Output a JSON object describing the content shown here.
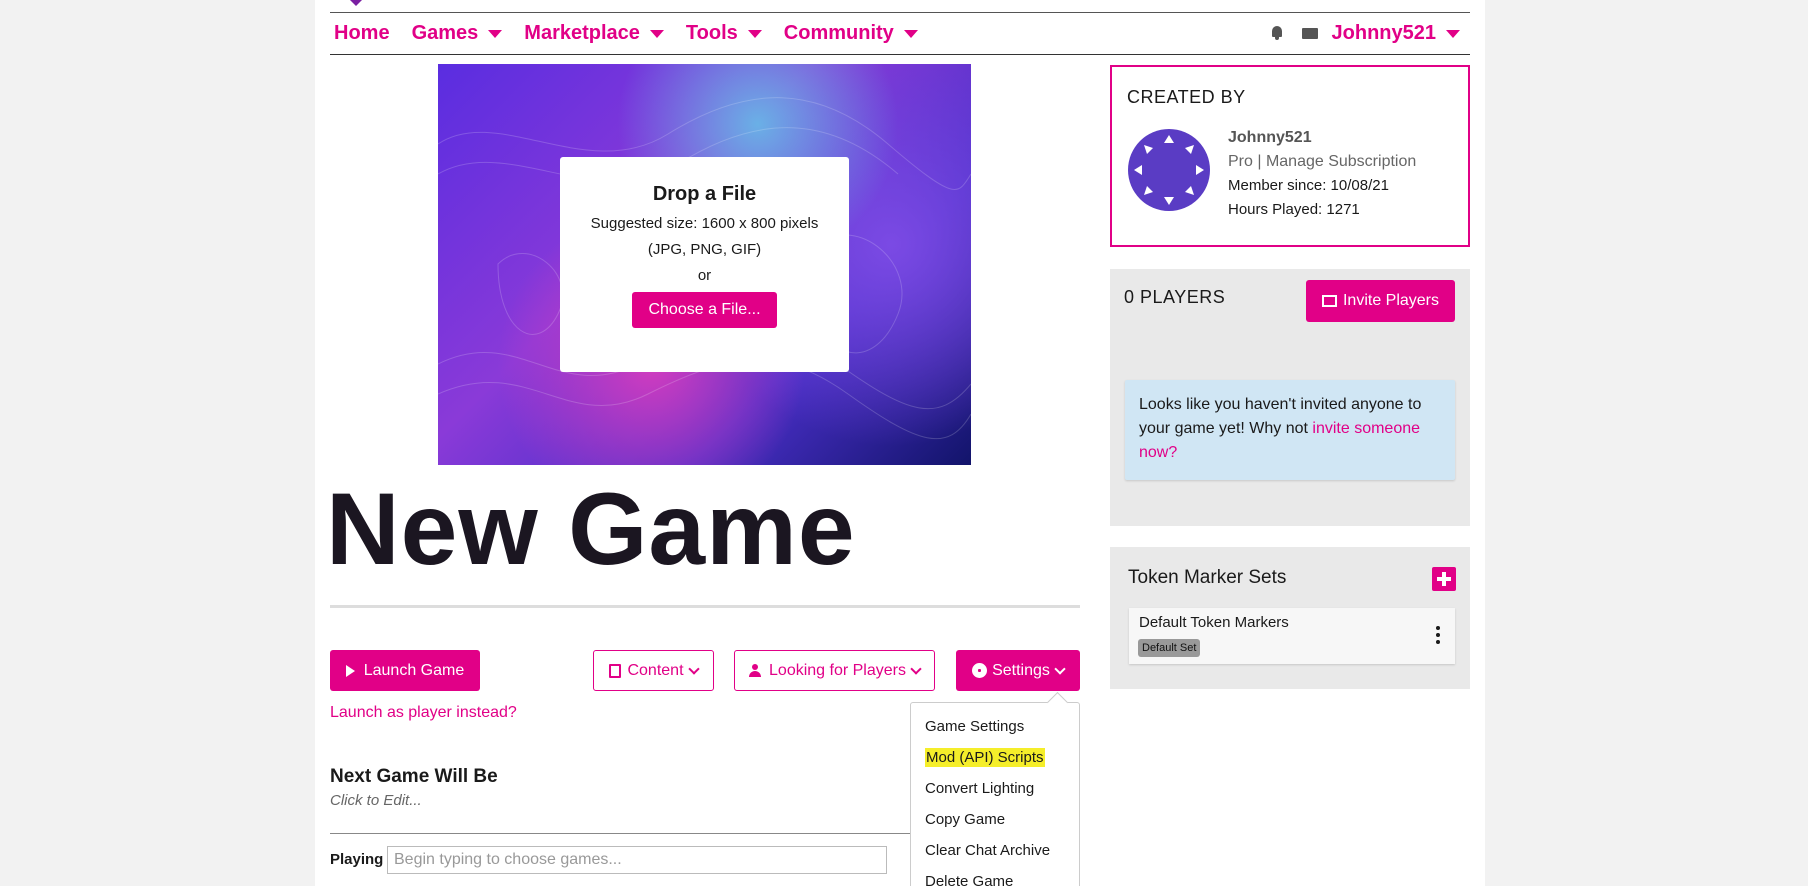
{
  "nav": {
    "items": [
      {
        "label": "Home",
        "has_caret": false
      },
      {
        "label": "Games",
        "has_caret": true
      },
      {
        "label": "Marketplace",
        "has_caret": true
      },
      {
        "label": "Tools",
        "has_caret": true
      },
      {
        "label": "Community",
        "has_caret": true
      }
    ],
    "user": "Johnny521",
    "icons": [
      "bell-icon",
      "mail-icon"
    ]
  },
  "upload": {
    "title": "Drop a File",
    "size_hint": "Suggested size: 1600 x 800 pixels",
    "formats": "(JPG, PNG, GIF)",
    "or": "or",
    "button": "Choose a File..."
  },
  "game": {
    "title": "New Game",
    "launch_label": "Launch Game",
    "content_label": "Content",
    "lfp_label": "Looking for Players",
    "settings_label": "Settings",
    "launch_player_link": "Launch as player instead?",
    "next_game_title": "Next Game Will Be",
    "click_to_edit": "Click to Edit...",
    "playing_label": "Playing",
    "playing_placeholder": "Begin typing to choose games..."
  },
  "settings_menu": {
    "items": [
      "Game Settings",
      "Mod (API) Scripts",
      "Convert Lighting",
      "Copy Game",
      "Clear Chat Archive",
      "Delete Game"
    ],
    "highlighted_index": 1
  },
  "creator": {
    "heading": "CREATED BY",
    "name": "Johnny521",
    "subscription": "Pro | Manage Subscription",
    "member_since": "Member since: 10/08/21",
    "hours_played": "Hours Played: 1271"
  },
  "players": {
    "count_label": "0 PLAYERS",
    "invite_button": "Invite Players",
    "info_text": "Looks like you haven't invited anyone to your game yet! Why not ",
    "info_link": "invite someone now?"
  },
  "tokens": {
    "heading": "Token Marker Sets",
    "set_name": "Default Token Markers",
    "badge": "Default Set"
  },
  "colors": {
    "accent": "#e10087",
    "info_bg": "#d0e6f4",
    "highlight": "#f5ee2a"
  }
}
